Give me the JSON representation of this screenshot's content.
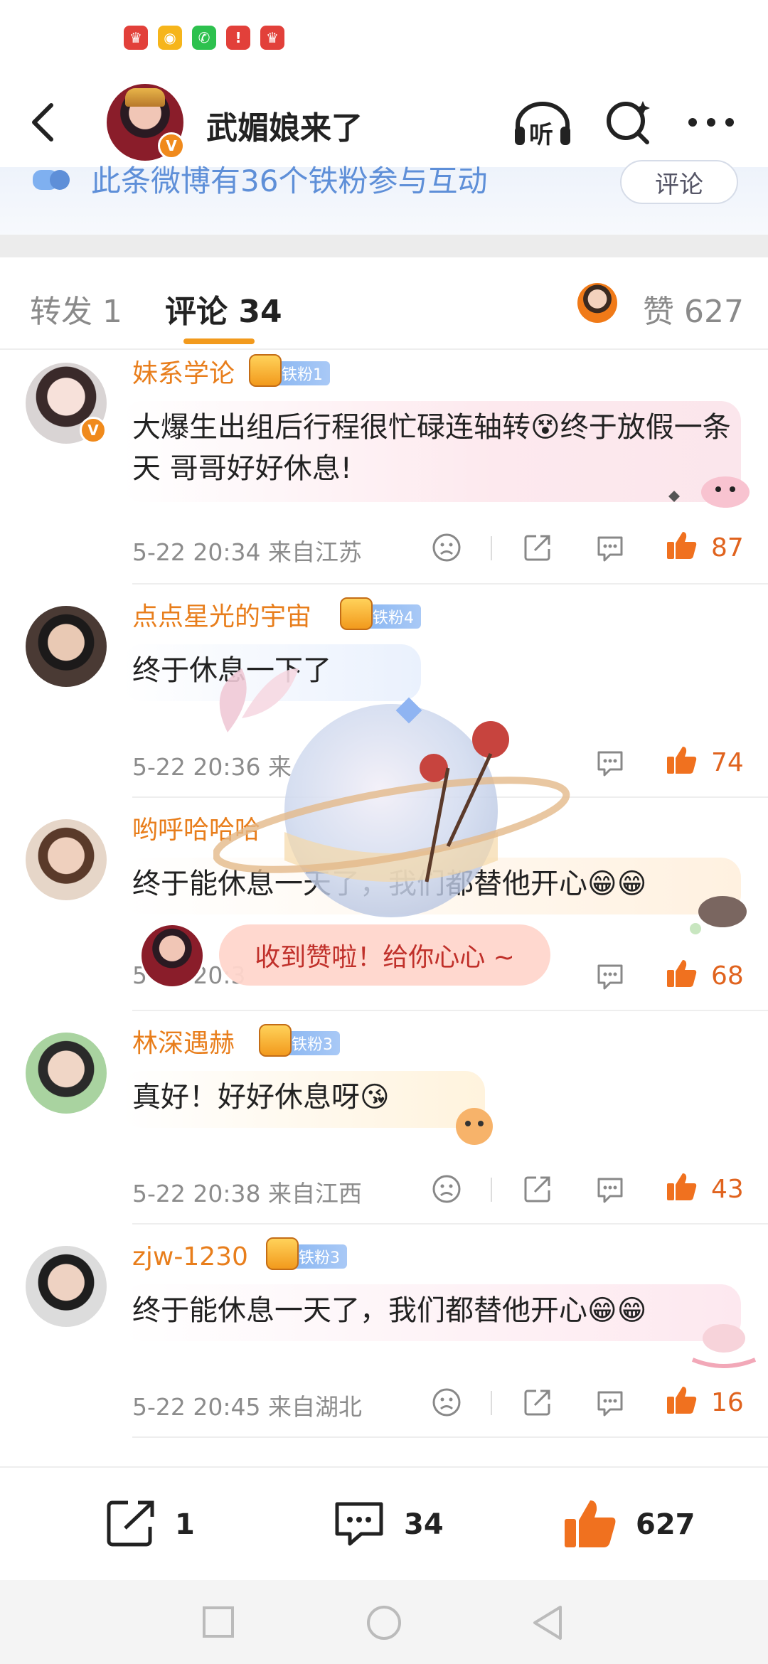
{
  "status_bar": {
    "app_icons": [
      {
        "name": "huawei-app-icon",
        "label": "♛",
        "color": "#e2403a"
      },
      {
        "name": "weibo-app-icon",
        "label": "◉",
        "color": "#f6b51b"
      },
      {
        "name": "wechat-app-icon",
        "label": "✆",
        "color": "#2dc14e"
      },
      {
        "name": "alert-app-icon",
        "label": "!",
        "color": "#e2403a"
      },
      {
        "name": "huawei-app-icon-2",
        "label": "♛",
        "color": "#e2403a"
      }
    ]
  },
  "header": {
    "title": "武媚娘来了",
    "listen_label": "听",
    "verified_badge": "V"
  },
  "fan_banner": {
    "text": "此条微博有36个铁粉参与互动",
    "button_label": "评论"
  },
  "tabs": {
    "repost_label": "转发",
    "repost_count": "1",
    "comment_label": "评论",
    "comment_count": "34",
    "like_label": "赞",
    "like_count": "627"
  },
  "comments": [
    {
      "username": "妹系学论",
      "fan_level": "铁粉1",
      "text": "大爆生出组后行程很忙碌连轴转😵终于放假一条天 哥哥好好休息!",
      "time": "5-22 20:34",
      "location": "来自江苏",
      "likes": "87"
    },
    {
      "username": "点点星光的宇宙",
      "fan_level": "铁粉4",
      "text": "终于休息一下了",
      "time": "5-22 20:36",
      "location": "来",
      "likes": "74"
    },
    {
      "username": "哟呼哈哈哈",
      "fan_level": "",
      "text": "终于能休息一天了，我们都替他开心😁😁",
      "time": "5-22 20:3",
      "location": "",
      "likes": "68"
    },
    {
      "username": "林深遇赫",
      "fan_level": "铁粉3",
      "text": "真好！好好休息呀😘",
      "time": "5-22 20:38",
      "location": "来自江西",
      "likes": "43"
    },
    {
      "username": "zjw-1230",
      "fan_level": "铁粉3",
      "text": "终于能休息一天了，我们都替他开心😁😁",
      "time": "5-22 20:45",
      "location": "来自湖北",
      "likes": "16"
    }
  ],
  "toast": {
    "text": "收到赞啦！给你心心 ~"
  },
  "bottom_bar": {
    "repost_count": "1",
    "comment_count": "34",
    "like_count": "627"
  },
  "colors": {
    "accent_orange": "#f29a1d",
    "username_orange": "#e87e1c",
    "like_red": "#e0631e",
    "fan_blue": "#5e8fd8"
  }
}
